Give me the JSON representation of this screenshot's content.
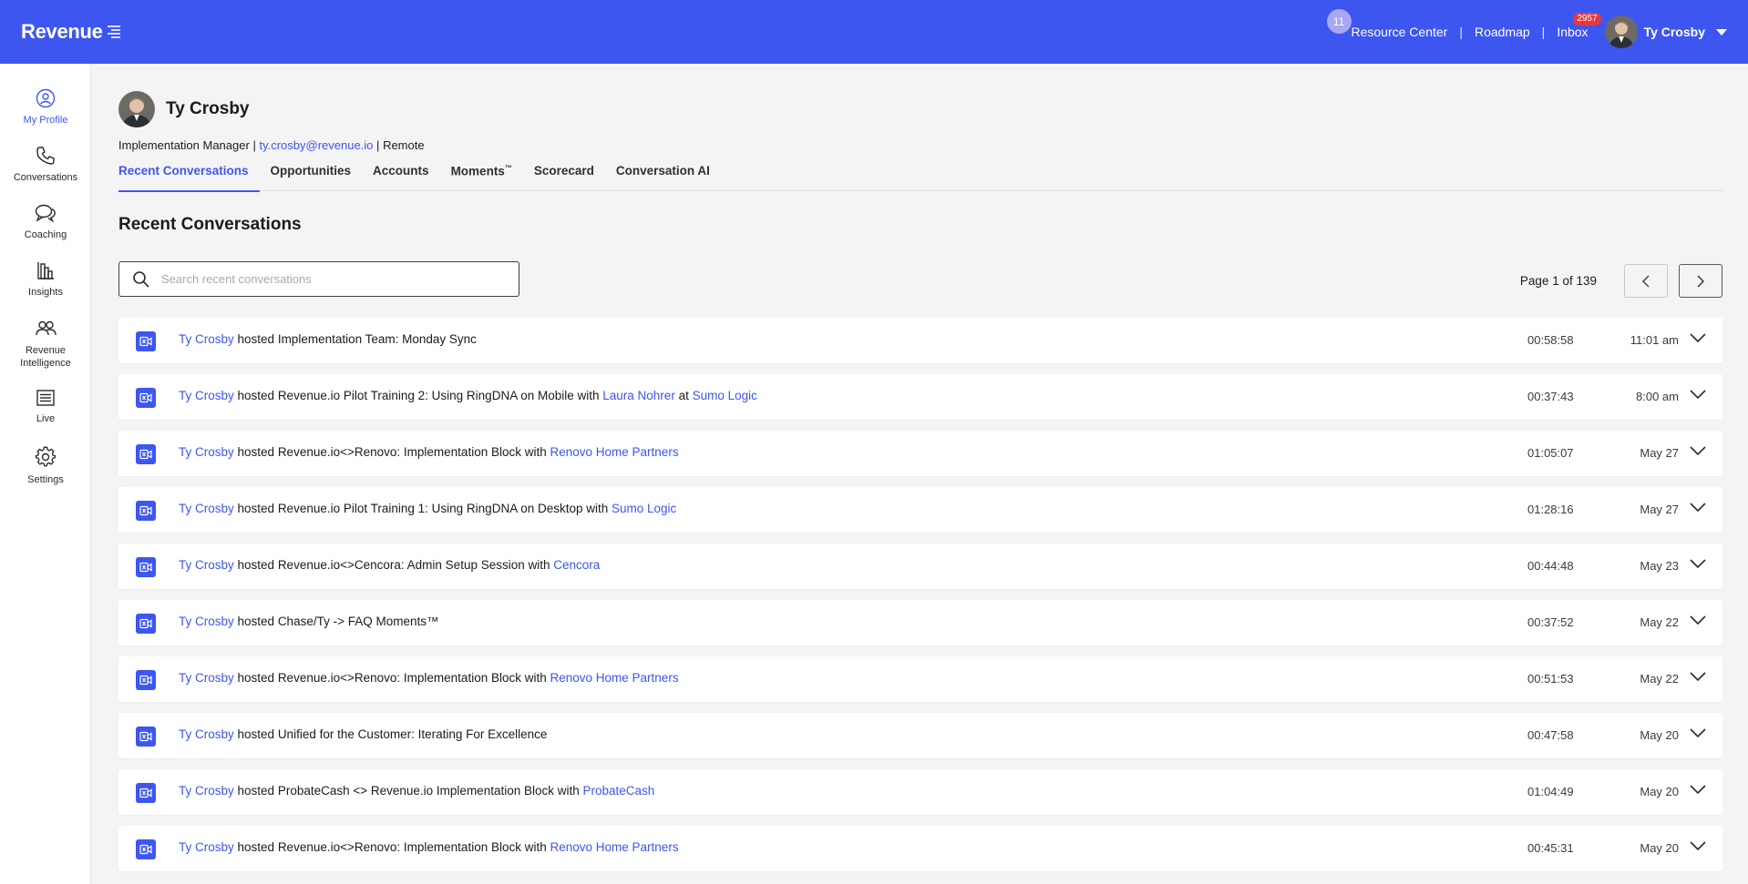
{
  "app": {
    "logo_text": "Revenue",
    "brand_color": "#3d56f0"
  },
  "topnav": {
    "resource_badge": "11",
    "resource_center": "Resource Center",
    "roadmap": "Roadmap",
    "inbox": "Inbox",
    "inbox_badge": "2957",
    "user_name": "Ty Crosby",
    "separator": "|"
  },
  "sidebar": {
    "items": [
      {
        "label": "My Profile",
        "icon": "user-circle-icon",
        "active": true
      },
      {
        "label": "Conversations",
        "icon": "phone-icon"
      },
      {
        "label": "Coaching",
        "icon": "chat-bubbles-icon"
      },
      {
        "label": "Insights",
        "icon": "bar-chart-icon"
      },
      {
        "label": "Revenue Intelligence",
        "icon": "people-icon"
      },
      {
        "label": "Live",
        "icon": "list-icon"
      },
      {
        "label": "Settings",
        "icon": "gear-icon"
      }
    ]
  },
  "profile": {
    "name": "Ty Crosby",
    "role": "Implementation Manager",
    "email": "ty.crosby@revenue.io",
    "location": "Remote",
    "sep": "|"
  },
  "tabs": [
    {
      "label": "Recent Conversations",
      "active": true
    },
    {
      "label": "Opportunities"
    },
    {
      "label": "Accounts"
    },
    {
      "label": "Moments",
      "sup": "™"
    },
    {
      "label": "Scorecard"
    },
    {
      "label": "Conversation AI"
    }
  ],
  "section": {
    "title": "Recent Conversations"
  },
  "search": {
    "placeholder": "Search recent conversations"
  },
  "pager": {
    "text": "Page 1 of 139"
  },
  "conversations": [
    {
      "host": "Ty Crosby",
      "verb": " hosted ",
      "title": "Implementation Team: Monday Sync",
      "with": "",
      "person": "",
      "at": "",
      "company": "",
      "duration": "00:58:58",
      "date": "11:01 am"
    },
    {
      "host": "Ty Crosby",
      "verb": " hosted ",
      "title": "Revenue.io Pilot Training 2: Using RingDNA on Mobile",
      "with": " with ",
      "person": "Laura Nohrer",
      "at": " at ",
      "company": "Sumo Logic",
      "duration": "00:37:43",
      "date": "8:00 am"
    },
    {
      "host": "Ty Crosby",
      "verb": " hosted ",
      "title": "Revenue.io<>Renovo: Implementation Block",
      "with": " with ",
      "person": "",
      "at": "",
      "company": "Renovo Home Partners",
      "duration": "01:05:07",
      "date": "May 27"
    },
    {
      "host": "Ty Crosby",
      "verb": " hosted ",
      "title": "Revenue.io Pilot Training 1: Using RingDNA on Desktop",
      "with": " with ",
      "person": "",
      "at": "",
      "company": "Sumo Logic",
      "duration": "01:28:16",
      "date": "May 27"
    },
    {
      "host": "Ty Crosby",
      "verb": " hosted ",
      "title": "Revenue.io<>Cencora: Admin Setup Session",
      "with": " with ",
      "person": "",
      "at": "",
      "company": "Cencora",
      "duration": "00:44:48",
      "date": "May 23"
    },
    {
      "host": "Ty Crosby",
      "verb": " hosted ",
      "title": "Chase/Ty -> FAQ Moments™",
      "with": "",
      "person": "",
      "at": "",
      "company": "",
      "duration": "00:37:52",
      "date": "May 22"
    },
    {
      "host": "Ty Crosby",
      "verb": " hosted ",
      "title": "Revenue.io<>Renovo: Implementation Block",
      "with": " with ",
      "person": "",
      "at": "",
      "company": "Renovo Home Partners",
      "duration": "00:51:53",
      "date": "May 22"
    },
    {
      "host": "Ty Crosby",
      "verb": " hosted ",
      "title": "Unified for the Customer: Iterating For Excellence",
      "with": "",
      "person": "",
      "at": "",
      "company": "",
      "duration": "00:47:58",
      "date": "May 20"
    },
    {
      "host": "Ty Crosby",
      "verb": " hosted ",
      "title": "ProbateCash <> Revenue.io Implementation Block",
      "with": " with ",
      "person": "",
      "at": "",
      "company": "ProbateCash",
      "duration": "01:04:49",
      "date": "May 20"
    },
    {
      "host": "Ty Crosby",
      "verb": " hosted ",
      "title": "Revenue.io<>Renovo: Implementation Block",
      "with": " with ",
      "person": "",
      "at": "",
      "company": "Renovo Home Partners",
      "duration": "00:45:31",
      "date": "May 20"
    }
  ]
}
